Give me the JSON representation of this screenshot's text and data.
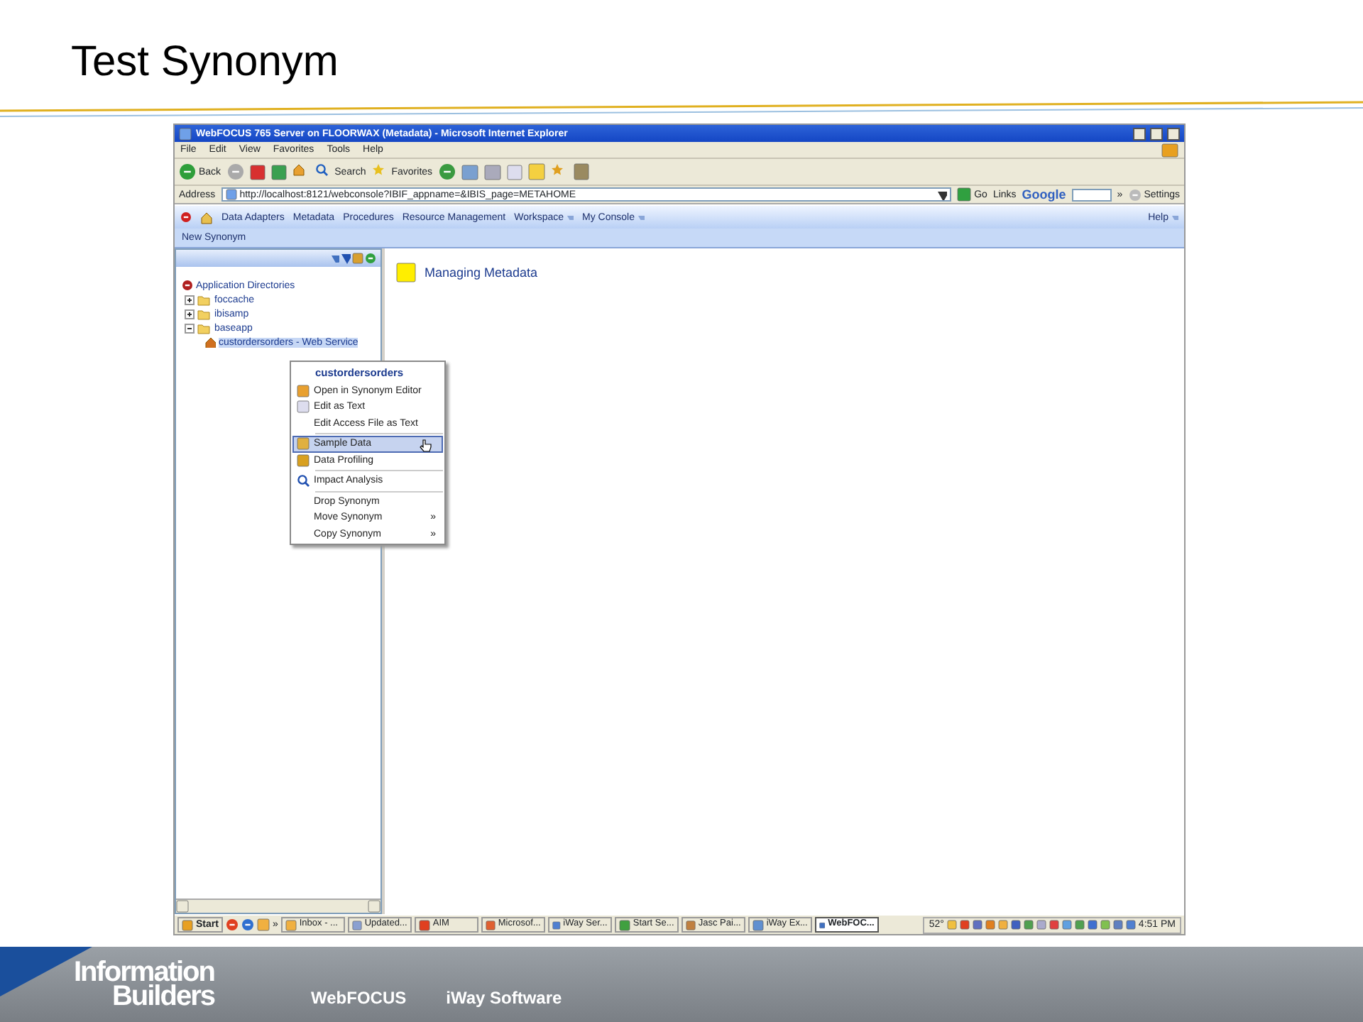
{
  "slide_title": "Test Synonym",
  "window": {
    "title": "WebFOCUS 765 Server on FLOORWAX (Metadata) - Microsoft Internet Explorer"
  },
  "menu": [
    "File",
    "Edit",
    "View",
    "Favorites",
    "Tools",
    "Help"
  ],
  "toolbar": {
    "back": "Back",
    "search": "Search",
    "favorites": "Favorites"
  },
  "address": {
    "label": "Address",
    "value": "http://localhost:8121/webconsole?IBIF_appname=&IBIS_page=METAHOME",
    "go": "Go",
    "links": "Links",
    "google": "Google",
    "more": "»",
    "settings": "Settings"
  },
  "app_nav": {
    "items": [
      {
        "label": "Data Adapters",
        "dropdown": false
      },
      {
        "label": "Metadata",
        "dropdown": false
      },
      {
        "label": "Procedures",
        "dropdown": false
      },
      {
        "label": "Resource Management",
        "dropdown": false
      },
      {
        "label": "Workspace",
        "dropdown": true
      },
      {
        "label": "My Console",
        "dropdown": true
      }
    ],
    "help": "Help"
  },
  "subbar": "New Synonym",
  "tree": {
    "label": "Application Directories",
    "children": [
      {
        "label": "foccache",
        "expanded": false
      },
      {
        "label": "ibisamp",
        "expanded": false
      },
      {
        "label": "baseapp",
        "expanded": true,
        "children": [
          {
            "label": "custordersorders - Web Service",
            "selected": true
          }
        ]
      }
    ]
  },
  "context_menu": {
    "title": "custordersorders",
    "groups": [
      [
        {
          "label": "Open in Synonym Editor",
          "selected": false
        },
        {
          "label": "Edit as Text",
          "selected": false
        },
        {
          "label": "Edit Access File as Text",
          "selected": false
        }
      ],
      [
        {
          "label": "Sample Data",
          "selected": true
        },
        {
          "label": "Data Profiling",
          "selected": false
        }
      ],
      [
        {
          "label": "Impact Analysis",
          "selected": false
        }
      ],
      [
        {
          "label": "Drop Synonym",
          "selected": false
        },
        {
          "label": "Move Synonym",
          "selected": false,
          "submenu": "»"
        },
        {
          "label": "Copy Synonym",
          "selected": false,
          "submenu": "»"
        }
      ]
    ]
  },
  "content": {
    "heading": "Managing Metadata"
  },
  "taskbar": {
    "start": "Start",
    "quick_more": "»",
    "items": [
      {
        "label": "Inbox - ...",
        "active": false
      },
      {
        "label": "Updated...",
        "active": false
      },
      {
        "label": "AIM",
        "active": false
      },
      {
        "label": "Microsof...",
        "active": false
      },
      {
        "label": "iWay Ser...",
        "active": false
      },
      {
        "label": "Start Se...",
        "active": false
      },
      {
        "label": "Jasc Pai...",
        "active": false
      },
      {
        "label": "iWay Ex...",
        "active": false
      },
      {
        "label": "WebFOC...",
        "active": true
      }
    ],
    "tray_text": "52°",
    "clock": "4:51 PM"
  },
  "footer": {
    "brand": [
      "Information",
      "Builders"
    ],
    "products": [
      "WebFOCUS",
      "iWay Software"
    ]
  }
}
